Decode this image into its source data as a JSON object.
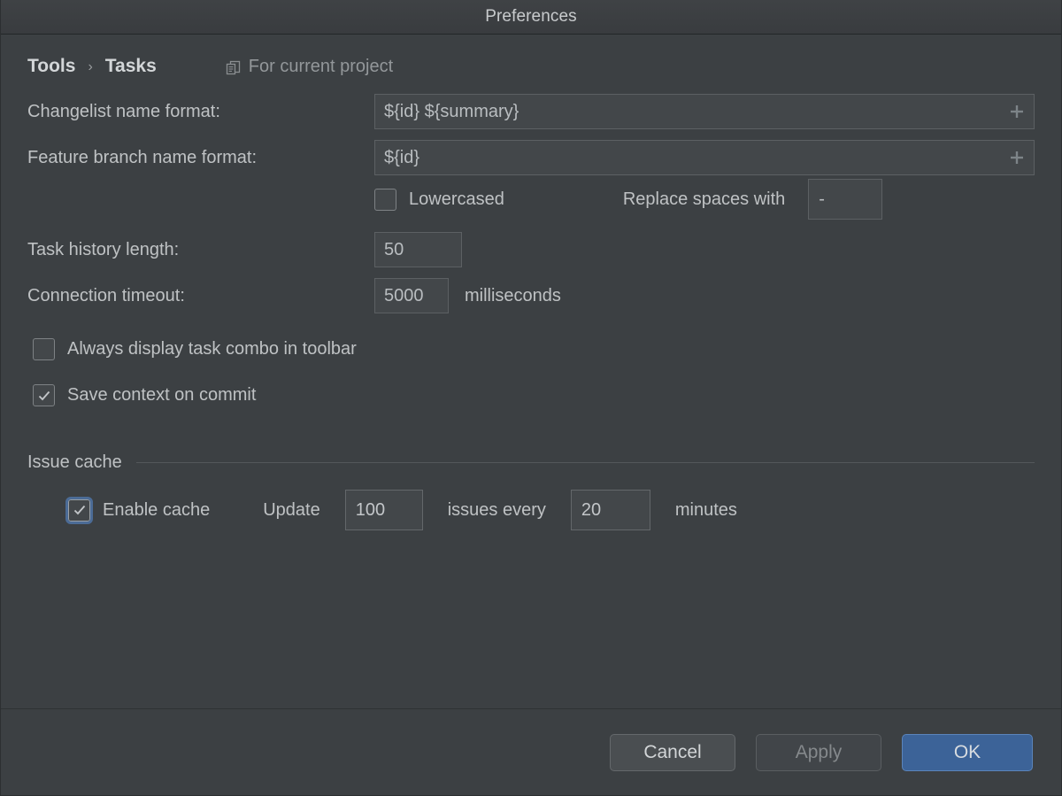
{
  "window": {
    "title": "Preferences"
  },
  "breadcrumb": {
    "parent": "Tools",
    "separator": "›",
    "current": "Tasks",
    "scope_icon": "copy-documents-icon",
    "scope_label": "For current project"
  },
  "fields": {
    "changelist": {
      "label": "Changelist name format:",
      "value": "${id} ${summary}",
      "add_icon": "plus-icon"
    },
    "feature_branch": {
      "label": "Feature branch name format:",
      "value": "${id}",
      "add_icon": "plus-icon"
    },
    "lowercased": {
      "label": "Lowercased",
      "checked": false
    },
    "replace_spaces": {
      "label": "Replace spaces with",
      "value": "-"
    },
    "task_history": {
      "label": "Task history length:",
      "value": "50"
    },
    "connection_timeout": {
      "label": "Connection timeout:",
      "value": "5000",
      "unit": "milliseconds"
    },
    "always_display_combo": {
      "label": "Always display task combo in toolbar",
      "checked": false
    },
    "save_context": {
      "label": "Save context on commit",
      "checked": true
    }
  },
  "issue_cache": {
    "section_title": "Issue cache",
    "enable": {
      "label": "Enable cache",
      "checked": true,
      "focused": true
    },
    "update_label": "Update",
    "issues_count": "100",
    "issues_every_label": "issues every",
    "interval": "20",
    "minutes_label": "minutes"
  },
  "footer": {
    "cancel": "Cancel",
    "apply": "Apply",
    "ok": "OK"
  },
  "colors": {
    "background": "#3c4043",
    "titlebar": "#3a3d40",
    "field_background": "#43474a",
    "field_border": "#5c6063",
    "text": "#bfc2c4",
    "muted_text": "#93979a",
    "accent_blue": "#3c6398",
    "focus_ring": "#4b6b96"
  }
}
